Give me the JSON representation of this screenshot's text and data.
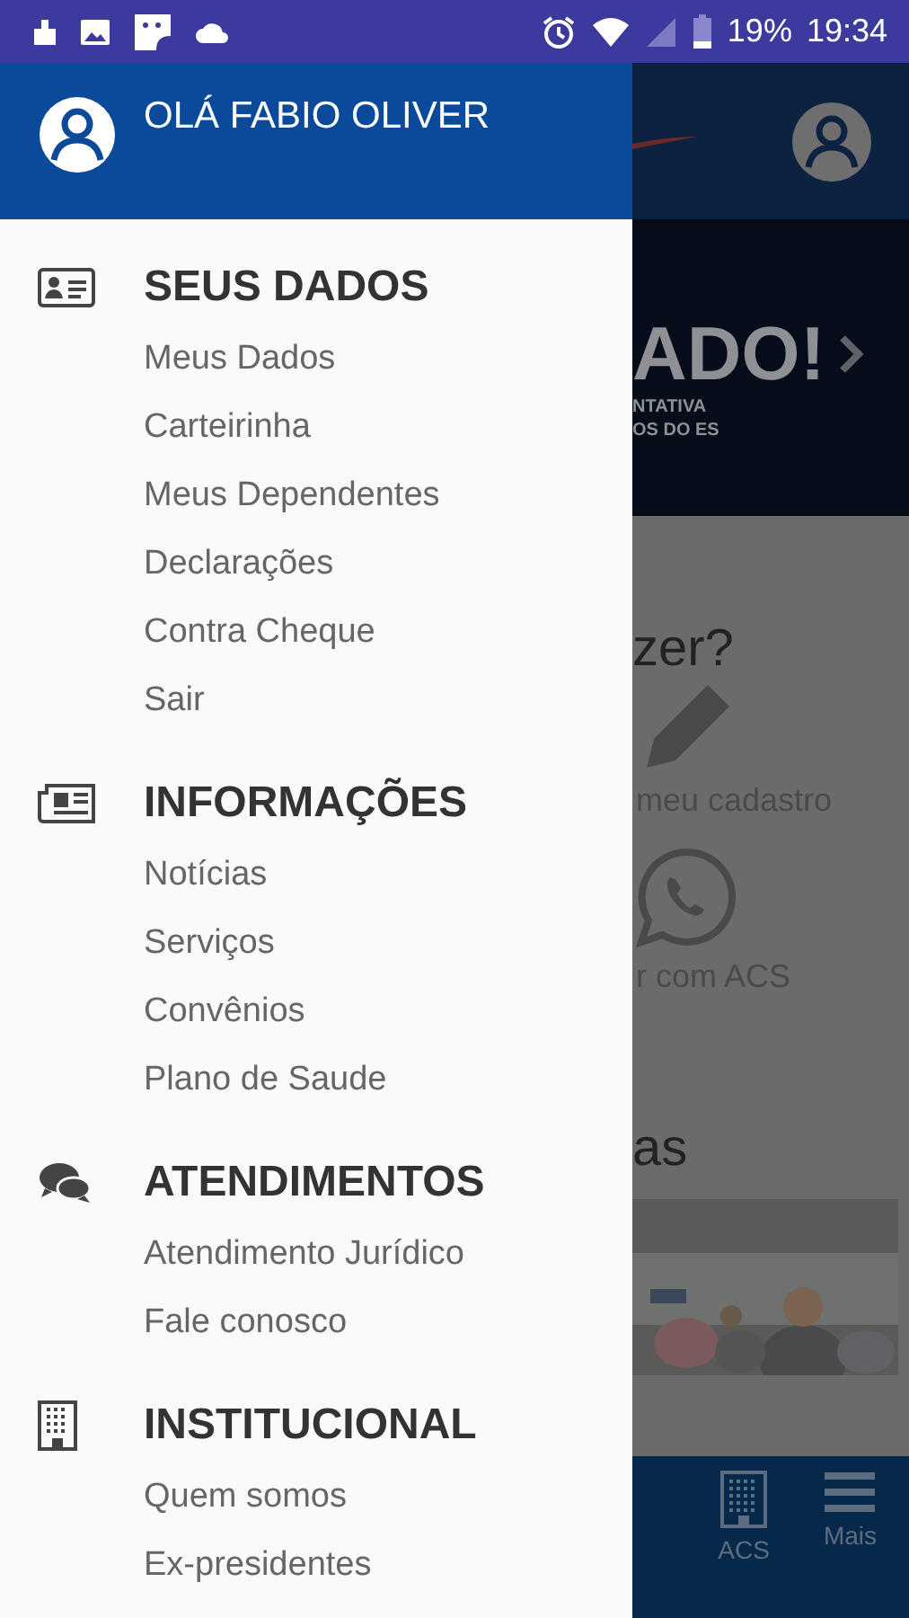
{
  "status_bar": {
    "battery": "19%",
    "time": "19:34"
  },
  "drawer": {
    "greeting": "OLÁ FABIO OLIVER",
    "sections": [
      {
        "kind": "id-card",
        "title": "SEUS DADOS",
        "items": [
          "Meus Dados",
          "Carteirinha",
          "Meus Dependentes",
          "Declarações",
          "Contra Cheque",
          "Sair"
        ]
      },
      {
        "kind": "newspaper",
        "title": "INFORMAÇÕES",
        "items": [
          "Notícias",
          "Serviços",
          "Convênios",
          "Plano de Saude"
        ]
      },
      {
        "kind": "chat",
        "title": "ATENDIMENTOS",
        "items": [
          "Atendimento Jurídico",
          "Fale conosco"
        ]
      },
      {
        "kind": "building",
        "title": "INSTITUCIONAL",
        "items": [
          "Quem somos",
          "Ex-presidentes"
        ]
      }
    ]
  },
  "background": {
    "banner_title": "ADO!",
    "banner_lines": [
      "NTATIVA",
      "OS DO ES"
    ],
    "heading": "zer?",
    "actions": [
      {
        "kind": "pencil",
        "label": "meu cadastro"
      },
      {
        "kind": "whatsapp",
        "label": "r com ACS"
      }
    ],
    "news_heading": "as",
    "nav": [
      {
        "kind": "building",
        "label": "ACS"
      },
      {
        "kind": "menu",
        "label": "Mais"
      }
    ]
  }
}
